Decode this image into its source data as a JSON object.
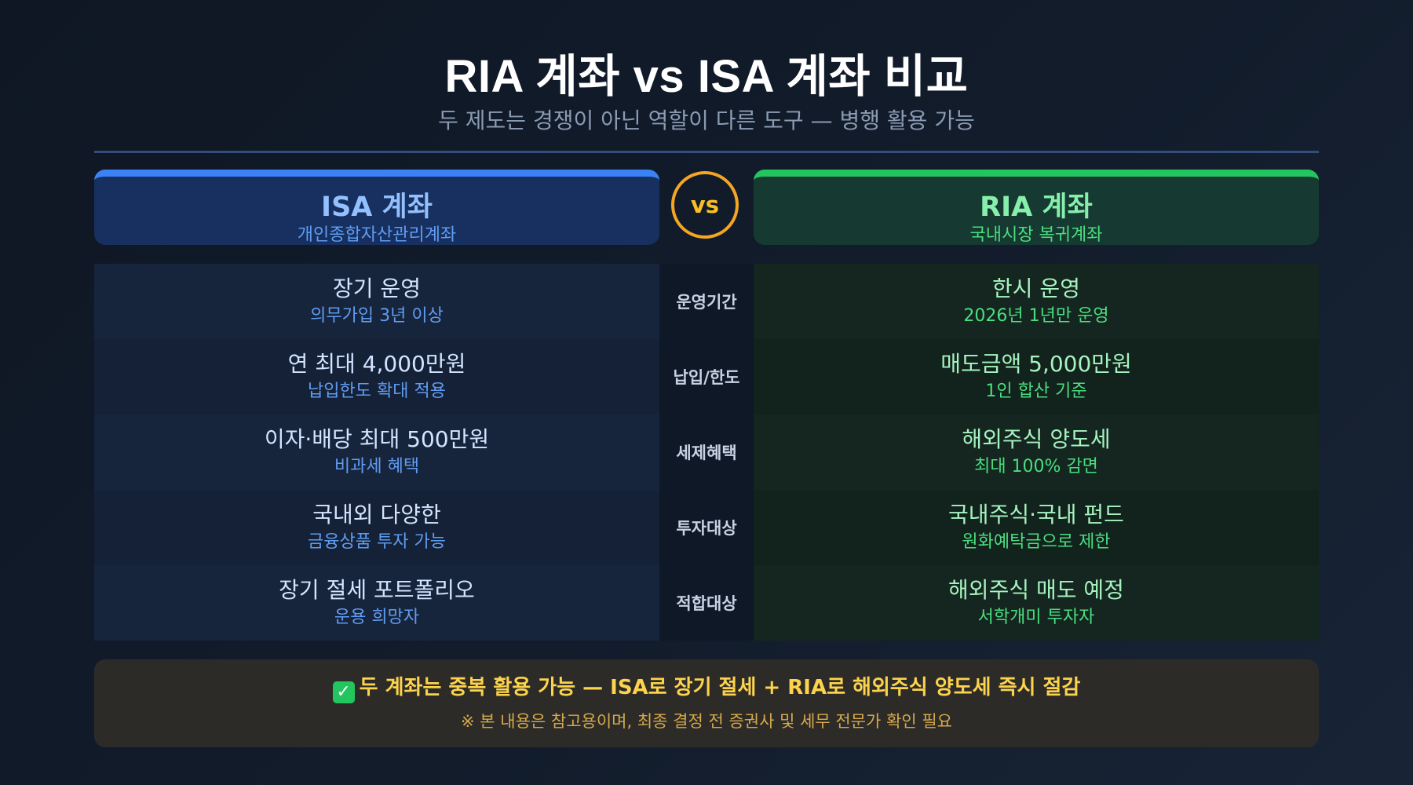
{
  "header": {
    "title": "RIA 계좌 vs ISA 계좌 비교",
    "subtitle": "두 제도는 경쟁이 아닌 역할이 다른 도구 — 병행 활용 가능"
  },
  "isa": {
    "name": "ISA 계좌",
    "full_name": "개인종합자산관리계좌",
    "accent_color": "#3b82f6"
  },
  "vs_label": "vs",
  "ria": {
    "name": "RIA 계좌",
    "full_name": "국내시장 복귀계좌",
    "accent_color": "#22c55e"
  },
  "rows": [
    {
      "category": "운영기간",
      "isa_main": "장기 운영",
      "isa_sub": "의무가입 3년 이상",
      "ria_main": "한시 운영",
      "ria_sub": "2026년 1년만 운영"
    },
    {
      "category": "납입/한도",
      "isa_main": "연 최대 4,000만원",
      "isa_sub": "납입한도 확대 적용",
      "ria_main": "매도금액 5,000만원",
      "ria_sub": "1인 합산 기준"
    },
    {
      "category": "세제혜택",
      "isa_main": "이자·배당 최대 500만원",
      "isa_sub": "비과세 혜택",
      "ria_main": "해외주식 양도세",
      "ria_sub": "최대 100% 감면"
    },
    {
      "category": "투자대상",
      "isa_main": "국내외 다양한",
      "isa_sub": "금융상품 투자 가능",
      "ria_main": "국내주식·국내 펀드",
      "ria_sub": "원화예탁금으로 제한"
    },
    {
      "category": "적합대상",
      "isa_main": "장기 절세 포트폴리오",
      "isa_sub": "운용 희망자",
      "ria_main": "해외주식 매도 예정",
      "ria_sub": "서학개미 투자자"
    }
  ],
  "footer": {
    "icon": "check-mark-icon",
    "main": "두 계좌는 중복 활용 가능 — ISA로 장기 절세 + RIA로 해외주식 양도세 즉시 절감",
    "note": "※ 본 내용은 참고용이며, 최종 결정 전 증권사 및 세무 전문가 확인 필요"
  }
}
